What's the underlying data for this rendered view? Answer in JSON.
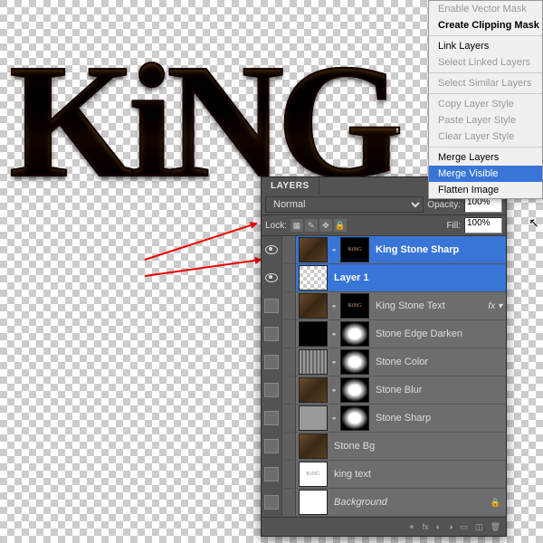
{
  "canvas_text": "KiNG",
  "panel": {
    "title": "LAYERS",
    "blend_mode": "Normal",
    "opacity_label": "Opacity:",
    "opacity_value": "100%",
    "lock_label": "Lock:",
    "fill_label": "Fill:",
    "fill_value": "100%"
  },
  "layers": [
    {
      "name": "King Stone Sharp",
      "visible": true,
      "selected": true,
      "thumbs": [
        "stone",
        "king-sm"
      ]
    },
    {
      "name": "Layer 1",
      "visible": true,
      "selected": true,
      "thumbs": [
        "trans"
      ]
    },
    {
      "name": "King Stone Text",
      "visible": false,
      "selected": false,
      "thumbs": [
        "stone",
        "king-sm"
      ],
      "fx": true
    },
    {
      "name": "Stone Edge Darken",
      "visible": false,
      "selected": false,
      "thumbs": [
        "black",
        "mask"
      ]
    },
    {
      "name": "Stone Color",
      "visible": false,
      "selected": false,
      "thumbs": [
        "pattern",
        "mask"
      ]
    },
    {
      "name": "Stone Blur",
      "visible": false,
      "selected": false,
      "thumbs": [
        "stone",
        "mask"
      ]
    },
    {
      "name": "Stone Sharp",
      "visible": false,
      "selected": false,
      "thumbs": [
        "gray",
        "mask"
      ]
    },
    {
      "name": "Stone Bg",
      "visible": false,
      "selected": false,
      "thumbs": [
        "stone"
      ]
    },
    {
      "name": "king text",
      "visible": false,
      "selected": false,
      "thumbs": [
        "kingw"
      ]
    },
    {
      "name": "Background",
      "visible": false,
      "selected": false,
      "thumbs": [
        "white"
      ],
      "italic": true,
      "locked": true
    }
  ],
  "context_menu": [
    {
      "label": "Enable Vector Mask",
      "disabled": true
    },
    {
      "label": "Create Clipping Mask",
      "bold": true
    },
    {
      "sep": true
    },
    {
      "label": "Link Layers"
    },
    {
      "label": "Select Linked Layers",
      "disabled": true
    },
    {
      "sep": true
    },
    {
      "label": "Select Similar Layers",
      "disabled": true
    },
    {
      "sep": true
    },
    {
      "label": "Copy Layer Style",
      "disabled": true
    },
    {
      "label": "Paste Layer Style",
      "disabled": true
    },
    {
      "label": "Clear Layer Style",
      "disabled": true
    },
    {
      "sep": true
    },
    {
      "label": "Merge Layers"
    },
    {
      "label": "Merge Visible",
      "hover": true
    },
    {
      "label": "Flatten Image"
    }
  ]
}
